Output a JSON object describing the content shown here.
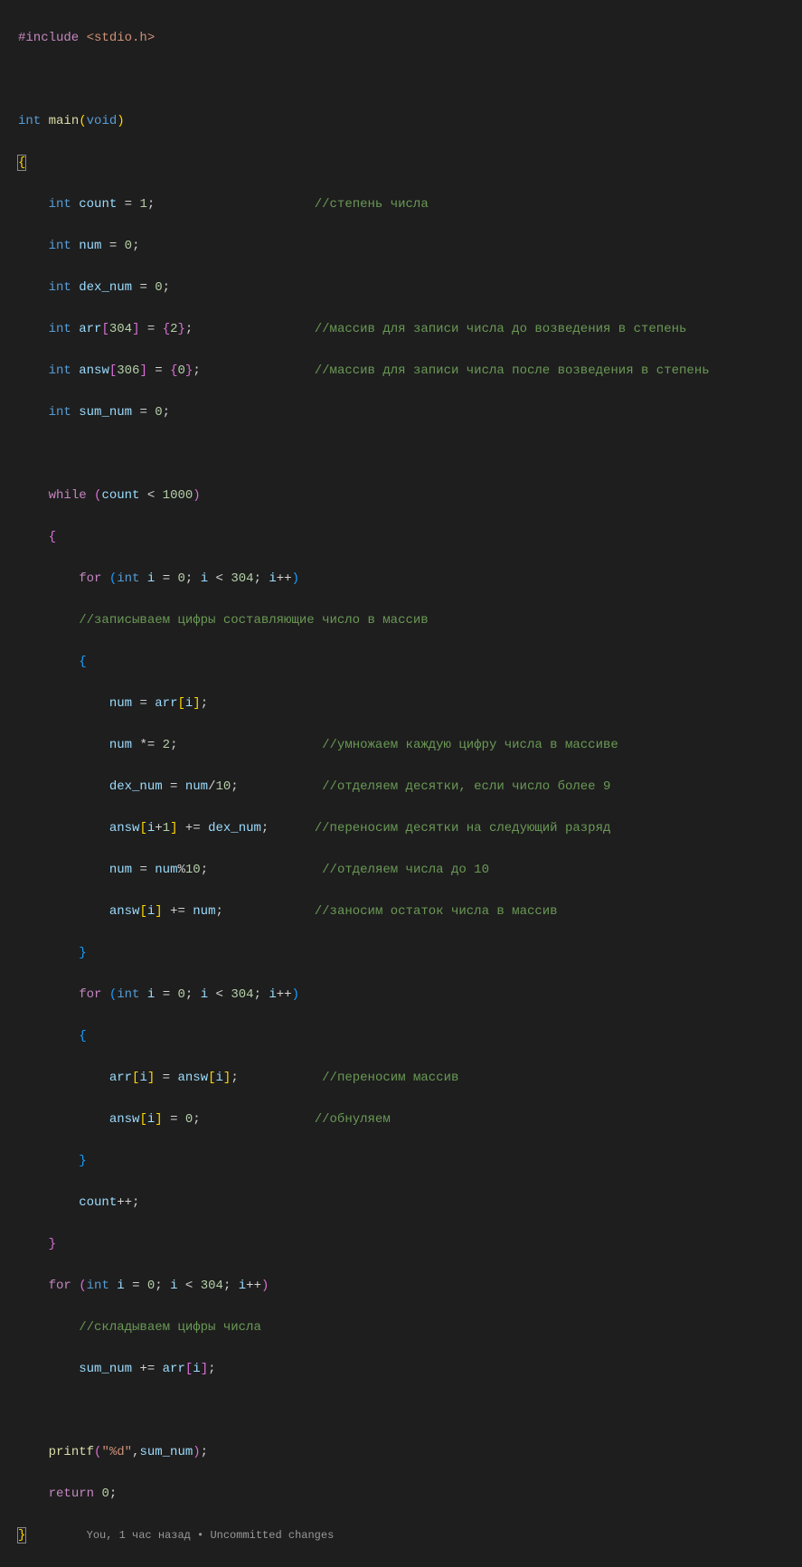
{
  "code": {
    "includeDirective": "#include",
    "includeHeader": "<stdio.h>",
    "kwInt": "int",
    "kwVoid": "void",
    "kwWhile": "while",
    "kwFor": "for",
    "kwReturn": "return",
    "fnMain": "main",
    "fnPrintf": "printf",
    "varCount": "count",
    "varNum": "num",
    "varDexNum": "dex_num",
    "varArr": "arr",
    "varAnsw": "answ",
    "varSumNum": "sum_num",
    "varI": "i",
    "num0": "0",
    "num1": "1",
    "num2": "2",
    "num10": "10",
    "num304": "304",
    "num306": "306",
    "num1000": "1000",
    "eq": "=",
    "semi": ";",
    "comma": ",",
    "lt": "<",
    "plusplus": "++",
    "stareq": "*=",
    "pluseq": "+=",
    "div": "/",
    "mod": "%",
    "plus": "+",
    "strFmt": "\"%d\"",
    "commentStepen": "//степень числа",
    "commentArrBefore": "//массив для записи числа до возведения в степень",
    "commentArrAfter": "//массив для записи числа после возведения в степень",
    "commentWriteDigits": "//записываем цифры составляющие число в массив",
    "commentMultiply": "//умножаем каждую цифру числа в массиве",
    "commentTens": "//отделяем десятки, если число более 9",
    "commentCarry": "//переносим десятки на следующий разряд",
    "commentUnder10": "//отделяем числа до 10",
    "commentRemainder": "//заносим остаток числа в массив",
    "commentTransfer": "//переносим массив",
    "commentZero": "//обнуляем",
    "commentSum": "//складываем цифры числа"
  },
  "codelens": "You, 1 час назад • Uncommitted changes"
}
